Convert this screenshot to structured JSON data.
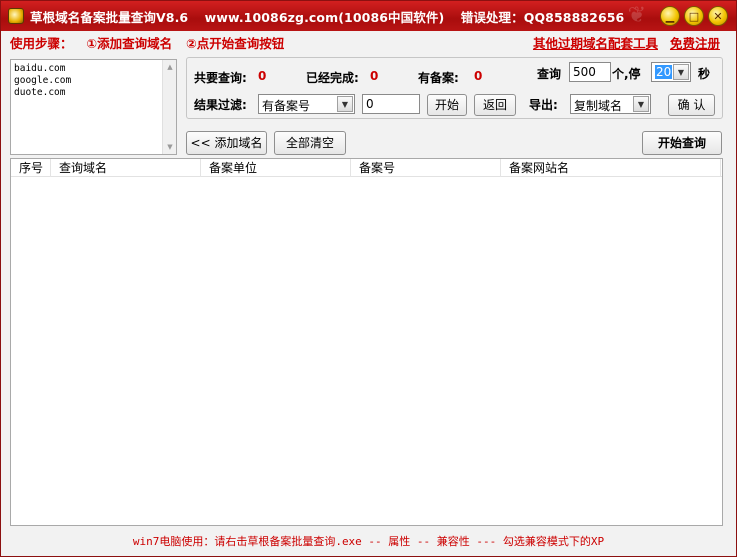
{
  "title": {
    "app_name": "草根域名备案批量查询V8.6",
    "website": "www.10086zg.com(10086中国软件)",
    "support": "错误处理：QQ858882656"
  },
  "steps": {
    "label": "使用步骤：",
    "step1": "①添加查询域名",
    "step2": "②点开始查询按钮"
  },
  "links": {
    "tools": "其他过期域名配套工具",
    "register": "免费注册"
  },
  "domains": [
    "baidu.com",
    "google.com",
    "duote.com"
  ],
  "stats": {
    "total_label": "共要查询:",
    "total_value": "0",
    "done_label": "已经完成:",
    "done_value": "0",
    "record_label": "有备案:",
    "record_value": "0"
  },
  "query": {
    "label": "查询",
    "count": "500",
    "unit": "个,停",
    "pause": "20",
    "sec": "秒"
  },
  "filter": {
    "label": "结果过滤:",
    "select_value": "有备案号",
    "input_value": "0",
    "start_button": "开始",
    "back_button": "返回"
  },
  "export": {
    "label": "导出:",
    "select_value": "复制域名",
    "confirm_button": "确 认"
  },
  "buttons": {
    "add_domain": "<< 添加域名",
    "clear_all": "全部清空",
    "start_query": "开始查询"
  },
  "table": {
    "columns": [
      "序号",
      "查询域名",
      "备案单位",
      "备案号",
      "备案网站名"
    ]
  },
  "footer": "win7电脑使用：请右击草根备案批量查询.exe -- 属性 -- 兼容性 --- 勾选兼容模式下的XP"
}
